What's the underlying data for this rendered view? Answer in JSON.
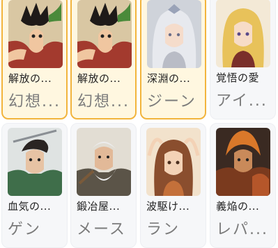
{
  "cards": [
    {
      "title": "解放の...",
      "subtitle": "幻想...",
      "selected": true,
      "icon": "boy-hero-portrait-icon"
    },
    {
      "title": "解放の...",
      "subtitle": "幻想...",
      "selected": true,
      "icon": "boy-hero-portrait-icon"
    },
    {
      "title": "深淵の...",
      "subtitle": "ジーン",
      "selected": true,
      "icon": "silver-hair-girl-portrait-icon"
    },
    {
      "title": "覚悟の愛",
      "subtitle": "アイ...",
      "selected": false,
      "icon": "blonde-girl-portrait-icon"
    },
    {
      "title": "血気の...",
      "subtitle": "ゲン",
      "selected": false,
      "icon": "swordsman-portrait-icon"
    },
    {
      "title": "鍛冶屋...",
      "subtitle": "メース",
      "selected": false,
      "icon": "old-warrior-portrait-icon"
    },
    {
      "title": "波駆け...",
      "subtitle": "ラン",
      "selected": false,
      "icon": "brown-hair-girl-portrait-icon"
    },
    {
      "title": "義焔の...",
      "subtitle": "レパ...",
      "selected": false,
      "icon": "flame-warrior-portrait-icon"
    }
  ]
}
